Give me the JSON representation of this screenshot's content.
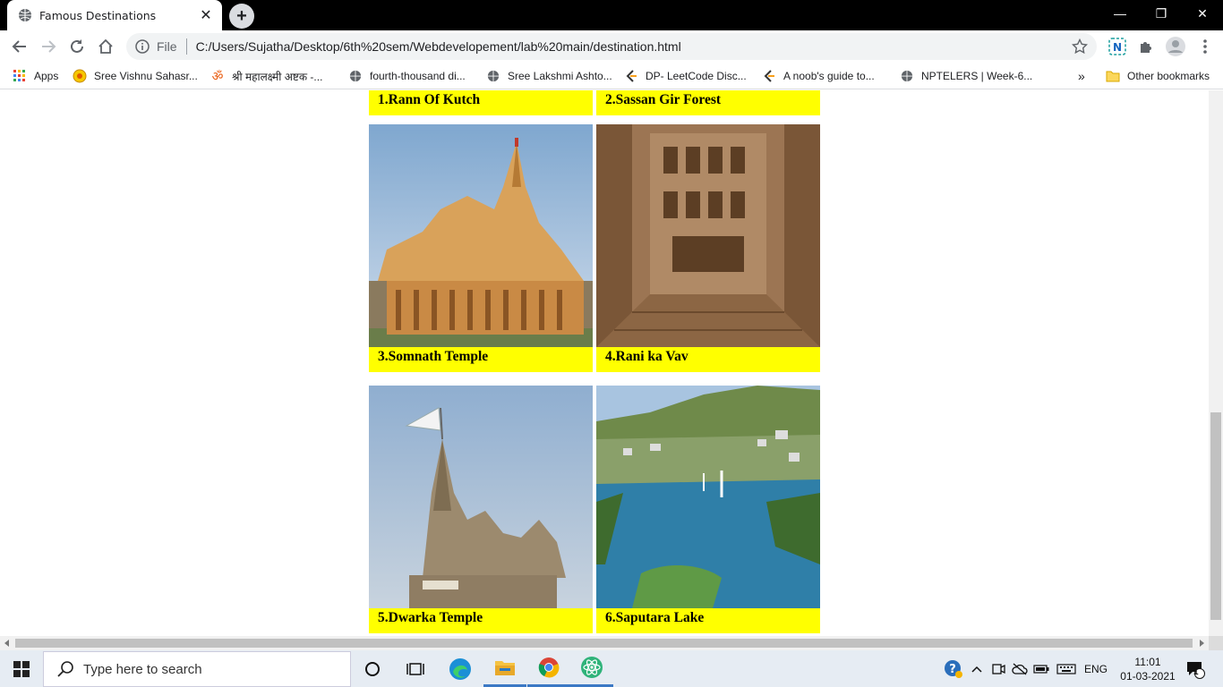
{
  "browser": {
    "tab_title": "Famous Destinations",
    "tab_close": "✕",
    "new_tab": "+",
    "win_min": "—",
    "win_restore": "❐",
    "win_close": "✕",
    "omnibox_file_label": "File",
    "url": "C:/Users/Sujatha/Desktop/6th%20sem/Webdevelopement/lab%20main/destination.html"
  },
  "bookmarks": {
    "items": [
      {
        "label": "Apps",
        "icon": "apps-grid-icon"
      },
      {
        "label": "Sree Vishnu Sahasr...",
        "icon": "sun-icon"
      },
      {
        "label": "श्री महालक्ष्मी अष्टक -...",
        "icon": "om-icon"
      },
      {
        "label": "fourth-thousand di...",
        "icon": "globe-icon"
      },
      {
        "label": "Sree Lakshmi Ashto...",
        "icon": "globe-icon"
      },
      {
        "label": "DP- LeetCode Disc...",
        "icon": "leetcode-icon"
      },
      {
        "label": "A noob's guide to...",
        "icon": "leetcode-icon"
      },
      {
        "label": "NPTELERS | Week-6...",
        "icon": "globe-icon"
      }
    ],
    "more": "»",
    "other": "Other bookmarks"
  },
  "page": {
    "cards": [
      {
        "caption": "1.Rann Of Kutch"
      },
      {
        "caption": "2.Sassan Gir Forest"
      },
      {
        "caption": "3.Somnath Temple"
      },
      {
        "caption": "4.Rani ka Vav"
      },
      {
        "caption": "5.Dwarka Temple"
      },
      {
        "caption": "6.Saputara Lake"
      }
    ],
    "caption_bg": "#ffff00"
  },
  "taskbar": {
    "search_placeholder": "Type here to search",
    "lang": "ENG",
    "time": "11:01",
    "date": "01-03-2021",
    "notification_count": "1"
  }
}
